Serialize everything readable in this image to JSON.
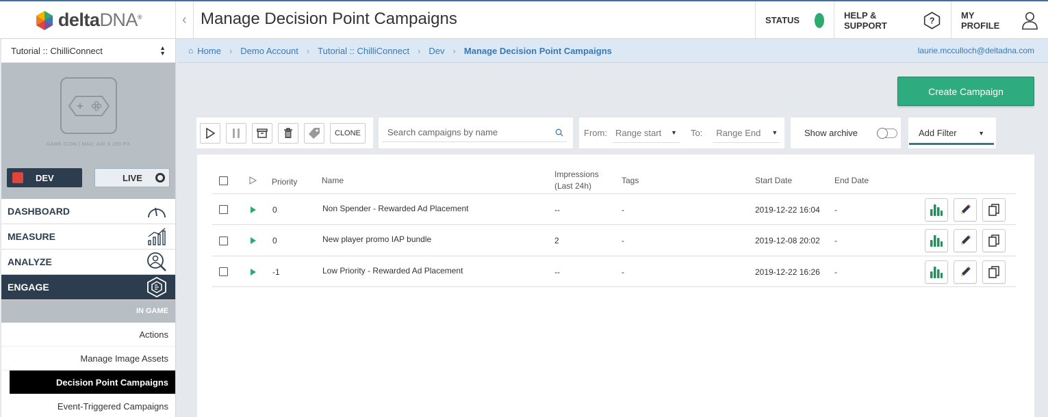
{
  "app": {
    "logo_main": "delta",
    "logo_accent": "DNA",
    "logo_mark": "®",
    "page_title": "Manage Decision Point Campaigns"
  },
  "topnav": {
    "status_label": "STATUS",
    "status_color": "#2eab6c",
    "help_label": "HELP & SUPPORT",
    "profile_label": "MY PROFILE"
  },
  "sidebar": {
    "project": "Tutorial :: ChilliConnect",
    "game_icon_caption": "GAME ICON  |  MAX: 400 X 250 PX",
    "env_dev": "DEV",
    "env_live": "LIVE",
    "nav": [
      {
        "label": "DASHBOARD",
        "icon": "gauge-icon"
      },
      {
        "label": "MEASURE",
        "icon": "bar-chart-icon"
      },
      {
        "label": "ANALYZE",
        "icon": "analyze-user-icon"
      },
      {
        "label": "ENGAGE",
        "icon": "engage-hex-icon"
      }
    ],
    "section_header": "IN GAME",
    "sub_items": [
      "Actions",
      "Manage Image Assets",
      "Decision Point Campaigns",
      "Event-Triggered Campaigns"
    ]
  },
  "breadcrumb": {
    "items": [
      "Home",
      "Demo Account",
      "Tutorial :: ChilliConnect",
      "Dev",
      "Manage Decision Point Campaigns"
    ],
    "user_email": "laurie.mcculloch@deltadna.com"
  },
  "toolbar": {
    "create_label": "Create Campaign",
    "clone_label": "CLONE",
    "search_placeholder": "Search campaigns by name",
    "from_label": "From:",
    "range_start": "Range start",
    "to_label": "To:",
    "range_end": "Range End",
    "archive_label": "Show archive",
    "filter_label": "Add Filter"
  },
  "table": {
    "headers": {
      "priority": "Priority",
      "name": "Name",
      "impressions_l1": "Impressions",
      "impressions_l2": "(Last 24h)",
      "tags": "Tags",
      "start": "Start Date",
      "end": "End Date"
    },
    "rows": [
      {
        "priority": "0",
        "name": "Non Spender - Rewarded Ad Placement",
        "impressions": "--",
        "tags": "-",
        "start": "2019-12-22 16:04",
        "end": "-"
      },
      {
        "priority": "0",
        "name": "New player promo IAP bundle",
        "impressions": "2",
        "tags": "-",
        "start": "2019-12-08 20:02",
        "end": "-"
      },
      {
        "priority": "-1",
        "name": "Low Priority - Rewarded Ad Placement",
        "impressions": "--",
        "tags": "-",
        "start": "2019-12-22 16:26",
        "end": "-"
      }
    ]
  }
}
